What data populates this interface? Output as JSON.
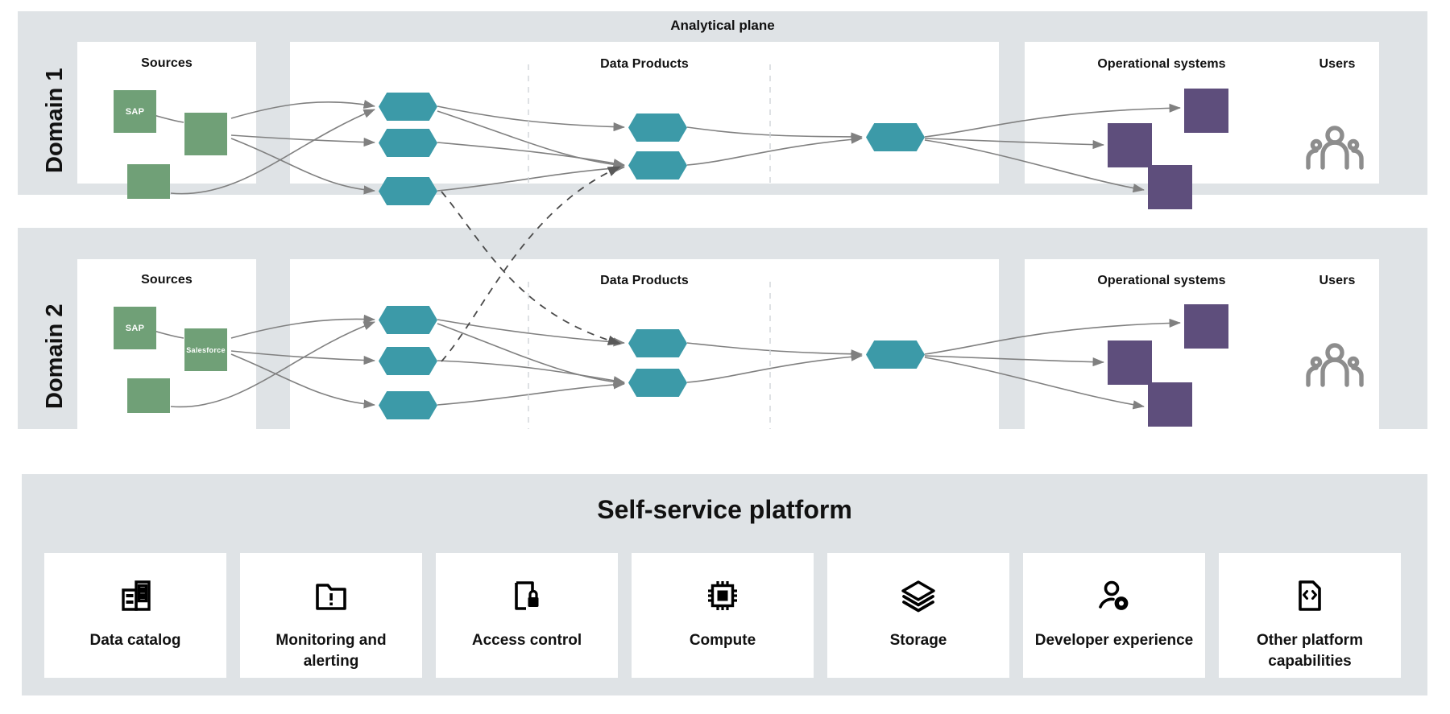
{
  "diagram": {
    "analytical_plane_title": "Analytical plane",
    "domains": [
      {
        "label": "Domain 1",
        "columns": {
          "sources": "Sources",
          "data_products": "Data Products",
          "operational_systems": "Operational systems",
          "users": "Users"
        },
        "sources": [
          {
            "label": "SAP"
          },
          {
            "label": ""
          },
          {
            "label": ""
          }
        ],
        "data_products_stage1": [
          "",
          "",
          ""
        ],
        "data_products_stage2": [
          "",
          ""
        ],
        "data_products_stage3": [
          ""
        ],
        "operational_systems": [
          "",
          "",
          ""
        ],
        "users_icon": "users-group-icon"
      },
      {
        "label": "Domain 2",
        "columns": {
          "sources": "Sources",
          "data_products": "Data Products",
          "operational_systems": "Operational systems",
          "users": "Users"
        },
        "sources": [
          {
            "label": "SAP"
          },
          {
            "label": "Salesforce"
          },
          {
            "label": ""
          }
        ],
        "data_products_stage1": [
          "",
          "",
          ""
        ],
        "data_products_stage2": [
          "",
          ""
        ],
        "data_products_stage3": [
          ""
        ],
        "operational_systems": [
          "",
          "",
          ""
        ],
        "users_icon": "users-group-icon"
      }
    ]
  },
  "self_service_platform": {
    "title": "Self-service platform",
    "capabilities": [
      {
        "label": "Data catalog",
        "icon": "data-catalog-icon"
      },
      {
        "label": "Monitoring and alerting",
        "icon": "folder-alert-icon"
      },
      {
        "label": "Access control",
        "icon": "document-lock-icon"
      },
      {
        "label": "Compute",
        "icon": "cpu-chip-icon"
      },
      {
        "label": "Storage",
        "icon": "layers-icon"
      },
      {
        "label": "Developer experience",
        "icon": "person-gear-icon"
      },
      {
        "label": "Other platform capabilities",
        "icon": "document-code-icon"
      }
    ]
  },
  "colors": {
    "band_background": "#dfe3e6",
    "panel_background": "#ffffff",
    "source_node": "#70a077",
    "data_product_node": "#3c9aa8",
    "operational_node": "#5e4e7c",
    "edge": "#808080",
    "cross_domain_edge": "#404040",
    "users_icon": "#8d8d8d"
  }
}
